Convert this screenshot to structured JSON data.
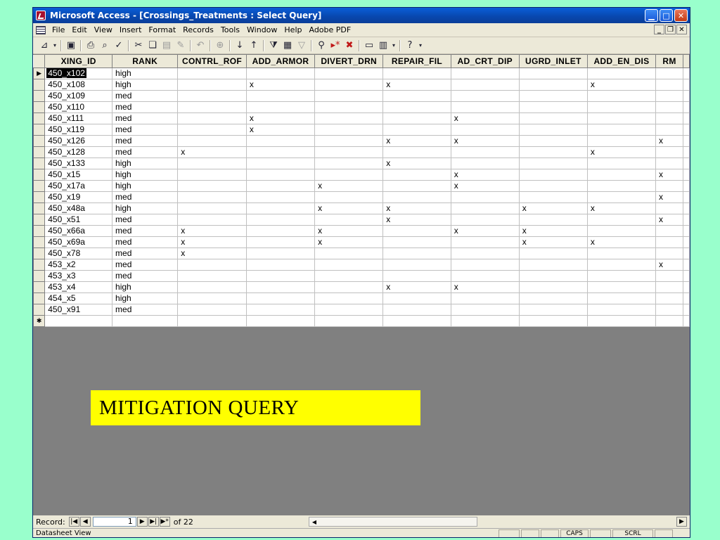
{
  "window": {
    "title": "Microsoft Access - [Crossings_Treatments : Select Query]"
  },
  "menu": [
    "File",
    "Edit",
    "View",
    "Insert",
    "Format",
    "Records",
    "Tools",
    "Window",
    "Help",
    "Adobe PDF"
  ],
  "table": {
    "columns": [
      "XING_ID",
      "RANK",
      "CONTRL_ROF",
      "ADD_ARMOR",
      "DIVERT_DRN",
      "REPAIR_FIL",
      "AD_CRT_DIP",
      "UGRD_INLET",
      "ADD_EN_DIS",
      "RM"
    ],
    "rows": [
      [
        "450_x102",
        "high",
        "",
        "",
        "",
        "",
        "",
        "",
        "",
        ""
      ],
      [
        "450_x108",
        "high",
        "",
        "x",
        "",
        "x",
        "",
        "",
        "x",
        ""
      ],
      [
        "450_x109",
        "med",
        "",
        "",
        "",
        "",
        "",
        "",
        "",
        ""
      ],
      [
        "450_x110",
        "med",
        "",
        "",
        "",
        "",
        "",
        "",
        "",
        ""
      ],
      [
        "450_x111",
        "med",
        "",
        "x",
        "",
        "",
        "x",
        "",
        "",
        ""
      ],
      [
        "450_x119",
        "med",
        "",
        "x",
        "",
        "",
        "",
        "",
        "",
        ""
      ],
      [
        "450_x126",
        "med",
        "",
        "",
        "",
        "x",
        "x",
        "",
        "",
        "x"
      ],
      [
        "450_x128",
        "med",
        "x",
        "",
        "",
        "",
        "",
        "",
        "x",
        ""
      ],
      [
        "450_x133",
        "high",
        "",
        "",
        "",
        "x",
        "",
        "",
        "",
        ""
      ],
      [
        "450_x15",
        "high",
        "",
        "",
        "",
        "",
        "x",
        "",
        "",
        "x"
      ],
      [
        "450_x17a",
        "high",
        "",
        "",
        "x",
        "",
        "x",
        "",
        "",
        ""
      ],
      [
        "450_x19",
        "med",
        "",
        "",
        "",
        "",
        "",
        "",
        "",
        "x"
      ],
      [
        "450_x48a",
        "high",
        "",
        "",
        "x",
        "x",
        "",
        "x",
        "x",
        ""
      ],
      [
        "450_x51",
        "med",
        "",
        "",
        "",
        "x",
        "",
        "",
        "",
        "x"
      ],
      [
        "450_x66a",
        "med",
        "x",
        "",
        "x",
        "",
        "x",
        "x",
        "",
        ""
      ],
      [
        "450_x69a",
        "med",
        "x",
        "",
        "x",
        "",
        "",
        "x",
        "x",
        ""
      ],
      [
        "450_x78",
        "med",
        "x",
        "",
        "",
        "",
        "",
        "",
        "",
        ""
      ],
      [
        "453_x2",
        "med",
        "",
        "",
        "",
        "",
        "",
        "",
        "",
        "x"
      ],
      [
        "453_x3",
        "med",
        "",
        "",
        "",
        "",
        "",
        "",
        "",
        ""
      ],
      [
        "453_x4",
        "high",
        "",
        "",
        "",
        "x",
        "x",
        "",
        "",
        ""
      ],
      [
        "454_x5",
        "high",
        "",
        "",
        "",
        "",
        "",
        "",
        "",
        ""
      ],
      [
        "450_x91",
        "med",
        "",
        "",
        "",
        "",
        "",
        "",
        "",
        ""
      ]
    ]
  },
  "overlay_label": "MITIGATION QUERY",
  "nav": {
    "record_label": "Record:",
    "current": "1",
    "of_text": "of 22"
  },
  "status": {
    "text": "Datasheet View",
    "caps": "CAPS",
    "scrl": "SCRL"
  }
}
